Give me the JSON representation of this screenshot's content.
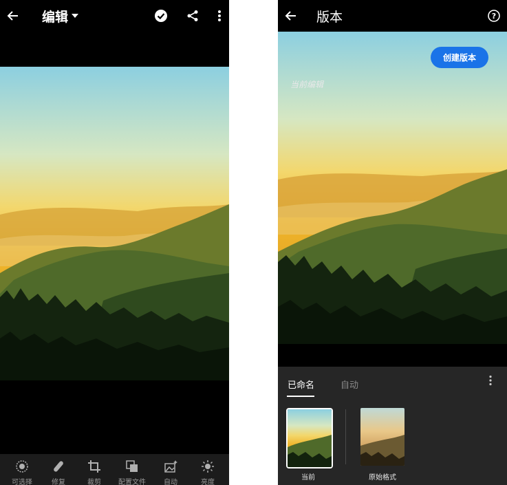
{
  "left": {
    "title": "编辑",
    "toolbar": [
      {
        "label": "可选择",
        "icon": "selective-icon"
      },
      {
        "label": "修复",
        "icon": "healing-icon"
      },
      {
        "label": "裁剪",
        "icon": "crop-icon"
      },
      {
        "label": "配置文件",
        "icon": "profiles-icon"
      },
      {
        "label": "自动",
        "icon": "auto-icon"
      },
      {
        "label": "亮度",
        "icon": "light-icon"
      }
    ]
  },
  "right": {
    "title": "版本",
    "current_edit": "当前编辑",
    "create_button": "创建版本",
    "tabs": [
      "已命名",
      "自动"
    ],
    "active_tab": "已命名",
    "versions": [
      {
        "label": "当前",
        "selected": true
      },
      {
        "label": "原始格式",
        "selected": false
      }
    ]
  },
  "colors": {
    "background": "#000000",
    "panel": "#262626",
    "accent": "#1a73e8"
  }
}
